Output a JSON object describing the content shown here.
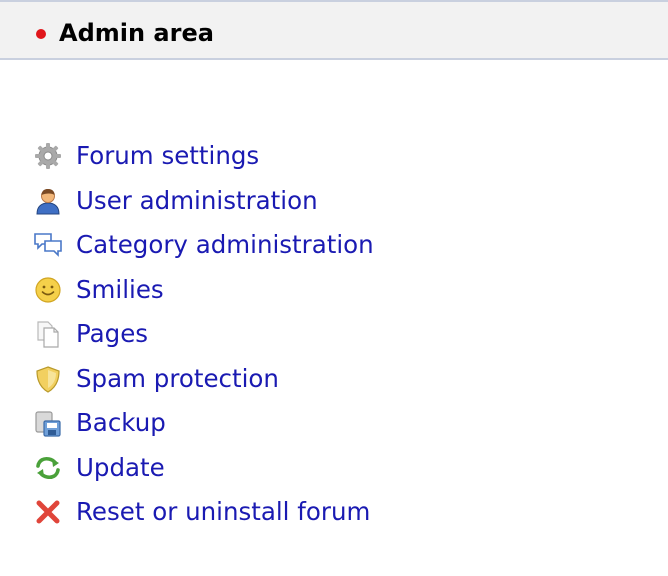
{
  "header": {
    "title": "Admin area",
    "status_color": "#e0161b"
  },
  "menu": {
    "items": [
      {
        "label": "Forum settings",
        "icon": "gear-icon"
      },
      {
        "label": "User administration",
        "icon": "user-icon"
      },
      {
        "label": "Category administration",
        "icon": "speech-bubbles-icon"
      },
      {
        "label": "Smilies",
        "icon": "smiley-icon"
      },
      {
        "label": "Pages",
        "icon": "pages-icon"
      },
      {
        "label": "Spam protection",
        "icon": "shield-icon"
      },
      {
        "label": "Backup",
        "icon": "backup-disk-icon"
      },
      {
        "label": "Update",
        "icon": "refresh-icon"
      },
      {
        "label": "Reset or uninstall forum",
        "icon": "red-x-icon"
      }
    ]
  },
  "colors": {
    "link": "#1a1ab2",
    "header_bg": "#f2f2f2",
    "header_border": "#c9d0df"
  }
}
